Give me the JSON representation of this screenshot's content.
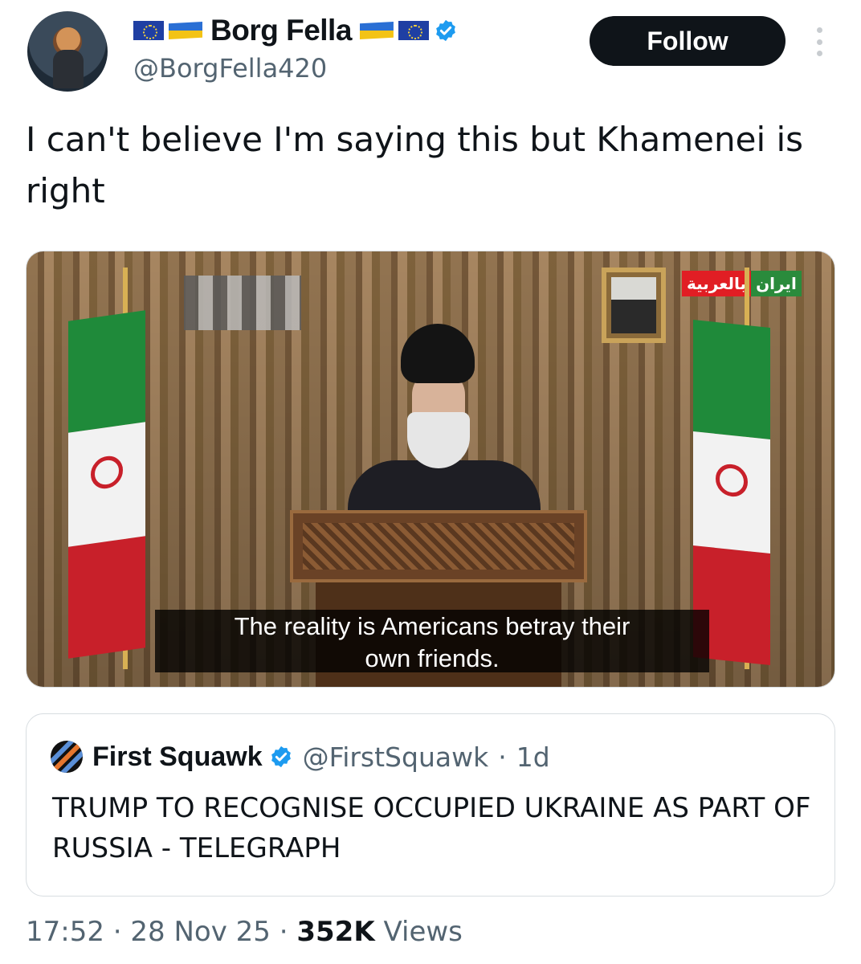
{
  "author": {
    "display_name": "Borg Fella",
    "handle": "@BorgFella420",
    "flags_left": [
      "eu-flag-icon",
      "ukraine-flag-icon"
    ],
    "flags_right": [
      "ukraine-flag-icon",
      "eu-flag-icon"
    ],
    "verified": true
  },
  "follow_label": "Follow",
  "tweet_text": "I can't believe I'm saying this but Khamenei is right",
  "media": {
    "subtitle_line1": "The reality is Americans betray their",
    "subtitle_line2": "own friends.",
    "channel_logo_part1": "ایران",
    "channel_logo_part2": "بالعربية"
  },
  "quoted_tweet": {
    "display_name": "First Squawk",
    "handle": "@FirstSquawk",
    "separator": "·",
    "age": "1d",
    "verified": true,
    "text": "TRUMP TO RECOGNISE OCCUPIED UKRAINE AS PART OF RUSSIA - TELEGRAPH"
  },
  "footer": {
    "time": "17:52",
    "separator": "·",
    "date": "28 Nov 25",
    "views_count": "352K",
    "views_label": "Views"
  },
  "colors": {
    "text_primary": "#0f1419",
    "text_secondary": "#536471",
    "verified_blue": "#1d9bf0",
    "follow_bg": "#0f1419"
  }
}
